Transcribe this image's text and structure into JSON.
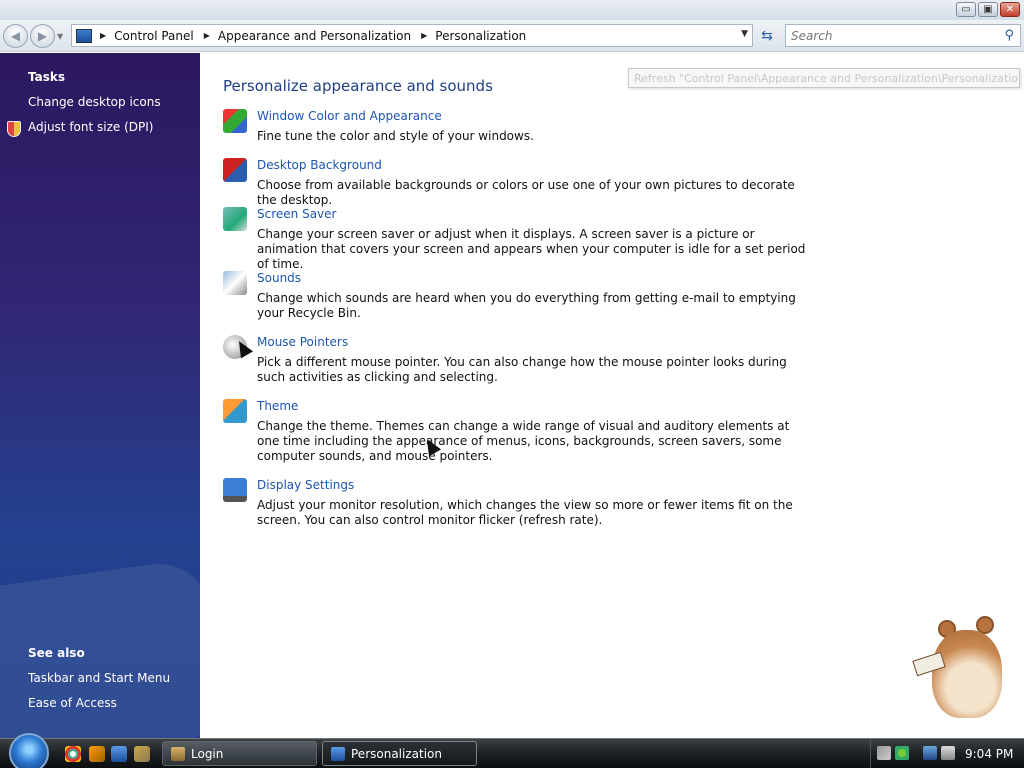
{
  "window": {
    "controls": {
      "minimize": "▭",
      "maximize": "▣",
      "close": "✕"
    }
  },
  "address_bar": {
    "breadcrumbs": [
      "Control Panel",
      "Appearance and Personalization",
      "Personalization"
    ],
    "search_placeholder": "Search",
    "back_icon": "back-arrow-icon",
    "forward_icon": "forward-arrow-icon"
  },
  "sidebar": {
    "tasks_heading": "Tasks",
    "tasks": [
      "Change desktop icons",
      "Adjust font size (DPI)"
    ],
    "see_also_heading": "See also",
    "see_also": [
      "Taskbar and Start Menu",
      "Ease of Access"
    ]
  },
  "main": {
    "title": "Personalize appearance and sounds",
    "tooltip": "Refresh \"Control Panel\\Appearance and Personalization\\Personalization\"",
    "items": [
      {
        "label": "Window Color and Appearance",
        "desc": "Fine tune the color and style of your windows.",
        "icon": "window-color-icon"
      },
      {
        "label": "Desktop Background",
        "desc": "Choose from available backgrounds or colors or use one of your own pictures to decorate the desktop.",
        "icon": "desktop-background-icon"
      },
      {
        "label": "Screen Saver",
        "desc": "Change your screen saver or adjust when it displays. A screen saver is a picture or animation that covers your screen and appears when your computer is idle for a set period of time.",
        "icon": "screen-saver-icon"
      },
      {
        "label": "Sounds",
        "desc": "Change which sounds are heard when you do everything from getting e-mail to emptying your Recycle Bin.",
        "icon": "sounds-icon"
      },
      {
        "label": "Mouse Pointers",
        "desc": "Pick a different mouse pointer. You can also change how the mouse pointer looks during such activities as clicking and selecting.",
        "icon": "mouse-pointers-icon"
      },
      {
        "label": "Theme",
        "desc": "Change the theme. Themes can change a wide range of visual and auditory elements at one time including the appearance of menus, icons, backgrounds, screen savers, some computer sounds, and mouse pointers.",
        "icon": "theme-icon"
      },
      {
        "label": "Display Settings",
        "desc": "Adjust your monitor resolution, which changes the view so more or fewer items fit on the screen. You can also control monitor flicker (refresh rate).",
        "icon": "display-settings-icon"
      }
    ]
  },
  "taskbar": {
    "tasks": [
      "Login",
      "Personalization"
    ],
    "clock": "9:04 PM"
  }
}
